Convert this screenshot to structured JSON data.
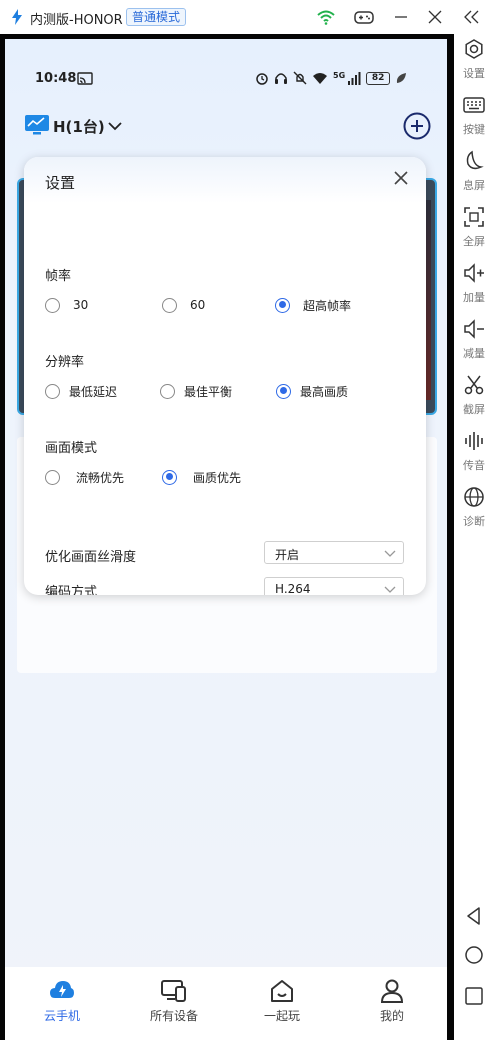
{
  "titlebar": {
    "title": "内测版-HONOR",
    "mode_badge": "普通模式",
    "icons": [
      "lightning-logo",
      "wifi-icon",
      "gamepad-icon",
      "minimize-icon",
      "close-icon",
      "collapse-icon"
    ],
    "wifi_color": "#22b14c"
  },
  "status_bar": {
    "time": "10:48",
    "battery": "82",
    "network": "5G",
    "icons": [
      "cast-icon",
      "alarm-icon",
      "headphones-icon",
      "mute-icon",
      "wifi-icon",
      "signal-icon",
      "battery-icon",
      "leaf-icon"
    ]
  },
  "device_selector": {
    "label": "H(1台)"
  },
  "settings": {
    "title": "设置",
    "frame_rate": {
      "title": "帧率",
      "options": [
        "30",
        "60",
        "超高帧率"
      ],
      "selected": "超高帧率"
    },
    "resolution": {
      "title": "分辨率",
      "options": [
        "最低延迟",
        "最佳平衡",
        "最高画质"
      ],
      "selected": "最高画质"
    },
    "display_mode": {
      "title": "画面模式",
      "options": [
        "流畅优先",
        "画质优先"
      ],
      "selected": "画质优先"
    },
    "smoothness": {
      "label": "优化画面丝滑度",
      "value": "开启"
    },
    "encoding": {
      "label": "编码方式",
      "value": "H.264"
    }
  },
  "bottom_nav": {
    "items": [
      {
        "label": "云手机",
        "icon": "cloud-phone-icon",
        "active": true
      },
      {
        "label": "所有设备",
        "icon": "devices-icon",
        "active": false
      },
      {
        "label": "一起玩",
        "icon": "play-together-icon",
        "active": false
      },
      {
        "label": "我的",
        "icon": "user-icon",
        "active": false
      }
    ]
  },
  "side_toolbar": {
    "items": [
      {
        "label": "设置",
        "icon": "settings-icon"
      },
      {
        "label": "按键",
        "icon": "keyboard-icon"
      },
      {
        "label": "息屏",
        "icon": "moon-icon"
      },
      {
        "label": "全屏",
        "icon": "fullscreen-icon"
      },
      {
        "label": "加量",
        "icon": "volume-up-icon"
      },
      {
        "label": "减量",
        "icon": "volume-down-icon"
      },
      {
        "label": "截屏",
        "icon": "scissors-icon"
      },
      {
        "label": "传音",
        "icon": "audio-wave-icon"
      },
      {
        "label": "诊断",
        "icon": "globe-icon"
      }
    ],
    "nav": [
      "back-icon",
      "home-icon",
      "recents-icon"
    ]
  },
  "colors": {
    "accent": "#2f6ae6",
    "brand_blue": "#1e7fe0"
  }
}
